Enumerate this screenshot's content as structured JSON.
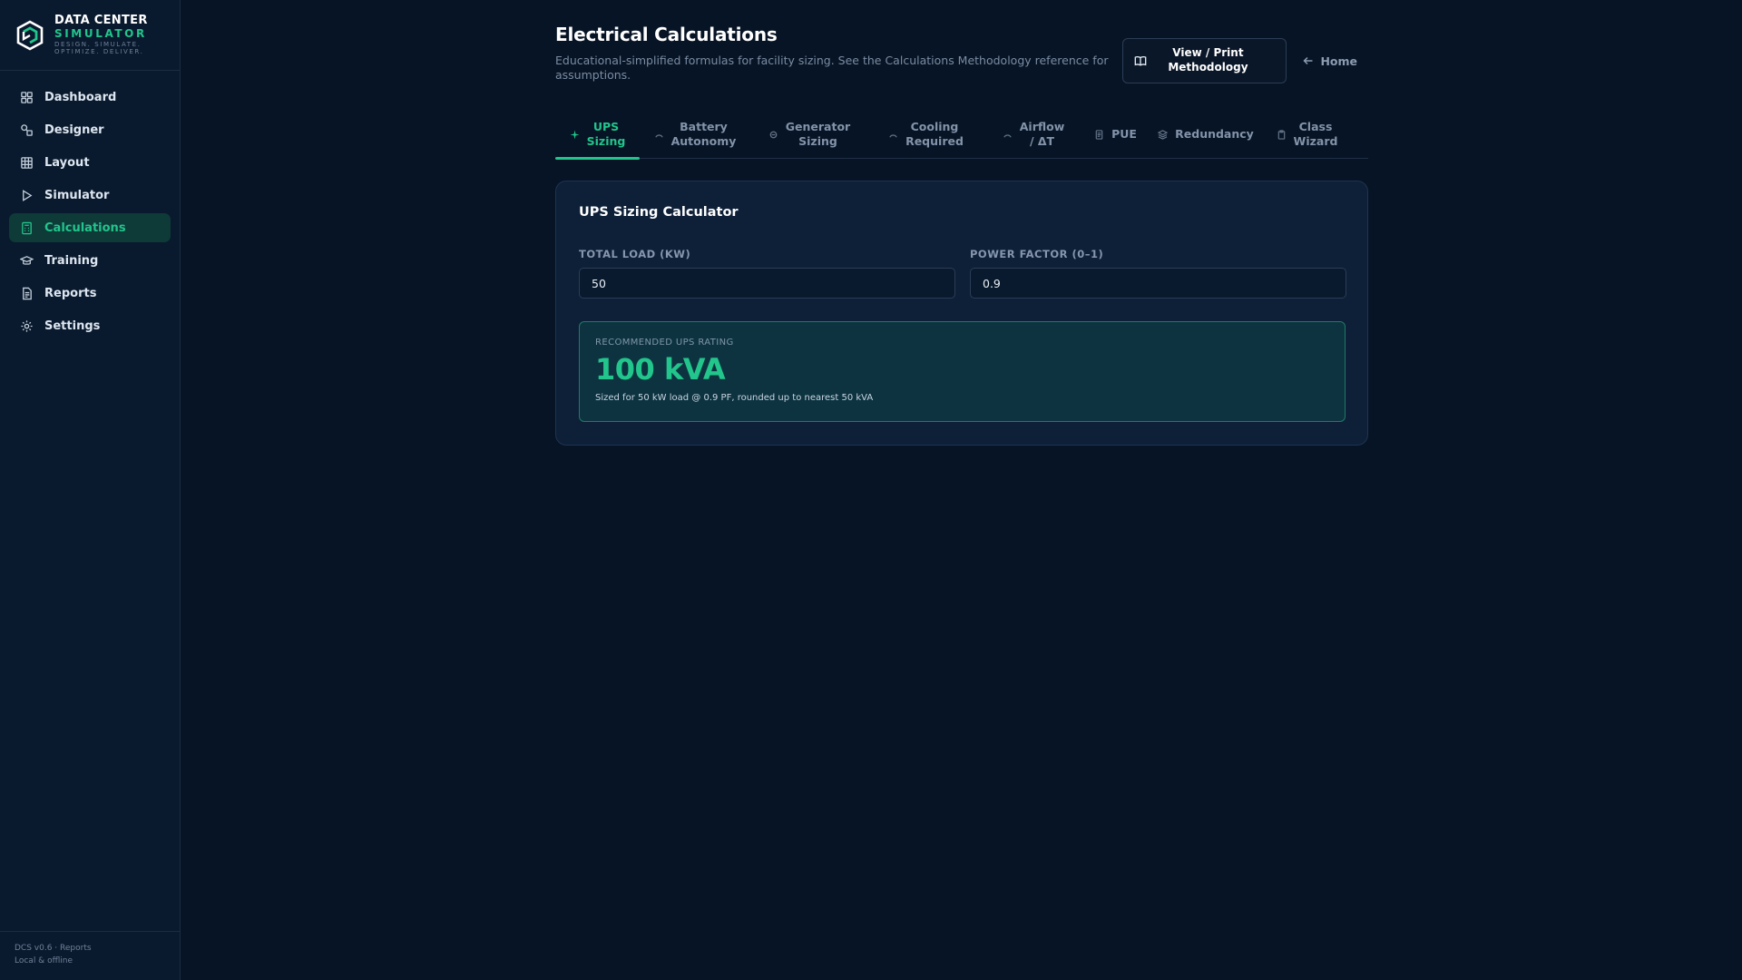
{
  "brand": {
    "line1": "DATA CENTER",
    "line2": "SIMULATOR",
    "line3": "DESIGN. SIMULATE.",
    "line4": "OPTIMIZE. DELIVER.",
    "accent_color": "#22c58b"
  },
  "sidebar": {
    "items": [
      {
        "label": "Dashboard",
        "icon": "grid-icon",
        "active": false
      },
      {
        "label": "Designer",
        "icon": "shapes-icon",
        "active": false
      },
      {
        "label": "Layout",
        "icon": "layout-grid-icon",
        "active": false
      },
      {
        "label": "Simulator",
        "icon": "play-icon",
        "active": false
      },
      {
        "label": "Calculations",
        "icon": "calculator-icon",
        "active": true
      },
      {
        "label": "Training",
        "icon": "graduation-cap-icon",
        "active": false
      },
      {
        "label": "Reports",
        "icon": "document-icon",
        "active": false
      },
      {
        "label": "Settings",
        "icon": "gear-icon",
        "active": false
      }
    ],
    "footer_line1": "DCS v0.6 · Reports",
    "footer_line2": "Local & offline"
  },
  "header": {
    "title": "Electrical Calculations",
    "subtitle": "Educational-simplified formulas for facility sizing. See the Calculations Methodology reference for assumptions.",
    "methodology_button": "View / Print\nMethodology",
    "home_link": "Home"
  },
  "tabs": [
    {
      "label": "UPS\nSizing",
      "icon": "sparkle-icon",
      "active": true
    },
    {
      "label": "Battery\nAutonomy",
      "icon": "gauge-icon",
      "active": false
    },
    {
      "label": "Generator\nSizing",
      "icon": "generator-icon",
      "active": false
    },
    {
      "label": "Cooling\nRequired",
      "icon": "gauge-icon",
      "active": false
    },
    {
      "label": "Airflow\n/ ΔT",
      "icon": "gauge-icon",
      "active": false
    },
    {
      "label": "PUE",
      "icon": "document-icon",
      "active": false
    },
    {
      "label": "Redundancy",
      "icon": "layers-icon",
      "active": false
    },
    {
      "label": "Class\nWizard",
      "icon": "clipboard-icon",
      "active": false
    }
  ],
  "calculator": {
    "title": "UPS Sizing Calculator",
    "fields": [
      {
        "label": "TOTAL LOAD (KW)",
        "value": "50"
      },
      {
        "label": "POWER FACTOR (0–1)",
        "value": "0.9"
      }
    ],
    "result": {
      "label": "RECOMMENDED UPS RATING",
      "value": "100 kVA",
      "note": "Sized for 50 kW load @ 0.9 PF, rounded up to nearest 50 kVA"
    }
  }
}
